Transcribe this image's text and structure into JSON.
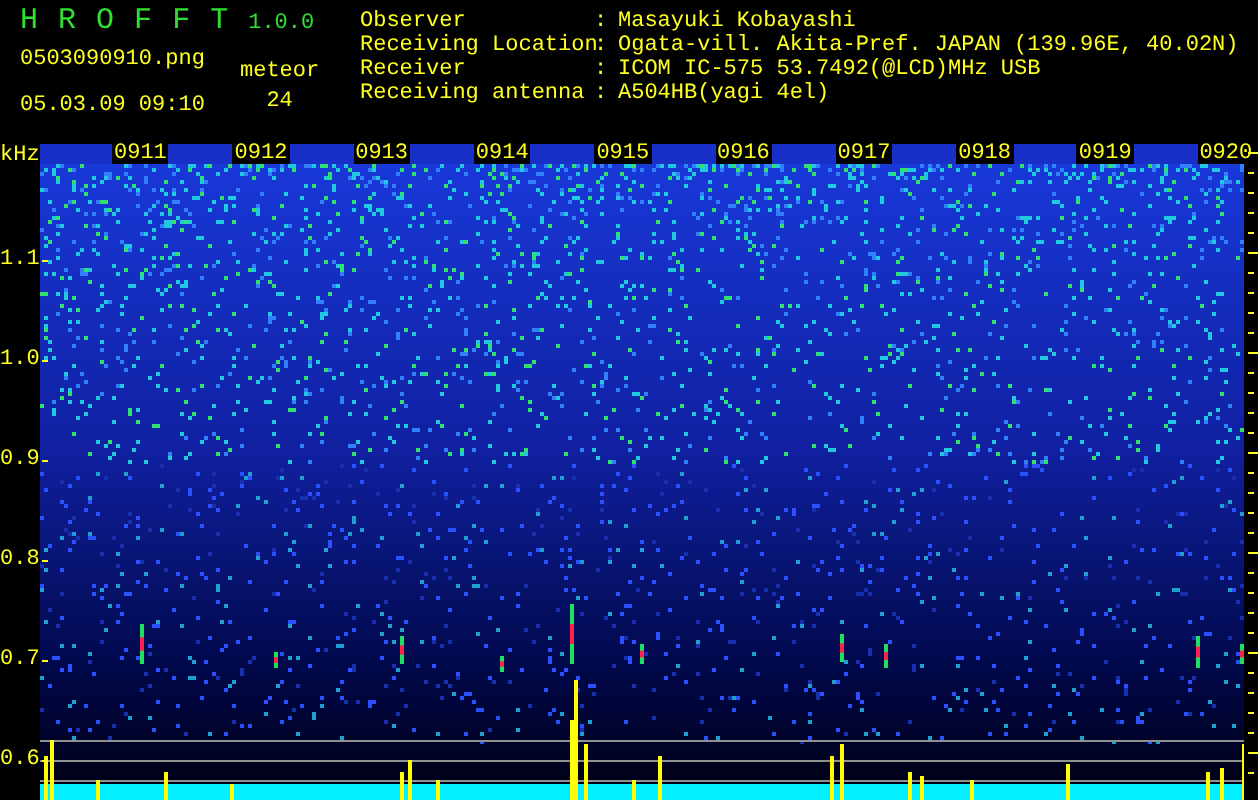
{
  "app": {
    "title_letters": [
      "H",
      "R",
      "O",
      "F",
      "F",
      "T"
    ],
    "version": "1.0.0",
    "file_name": "0503090910.png",
    "date_time": "05.03.09 09:10",
    "count_label": "meteor",
    "count": "24"
  },
  "station": [
    {
      "label": "Observer",
      "separator": ":",
      "value": "Masayuki Kobayashi"
    },
    {
      "label": "Receiving Location",
      "separator": ":",
      "value": "Ogata-vill. Akita-Pref. JAPAN (139.96E, 40.02N)"
    },
    {
      "label": "Receiver",
      "separator": ":",
      "value": "ICOM IC-575 53.7492(@LCD)MHz USB"
    },
    {
      "label": "Receiving antenna",
      "separator": ":",
      "value": "A504HB(yagi 4el)"
    }
  ],
  "spectrogram": {
    "unit": "kHz",
    "frequency_labels": [
      "1.1",
      "1.0",
      "0.9",
      "0.8",
      "0.7",
      "0.6"
    ],
    "time_labels": [
      "0911",
      "0912",
      "0913",
      "0914",
      "0915",
      "0916",
      "0917",
      "0918",
      "0919",
      "0920"
    ]
  }
}
